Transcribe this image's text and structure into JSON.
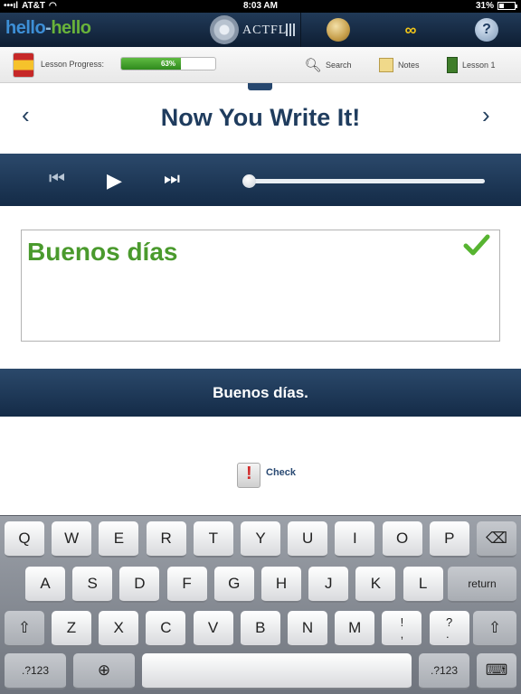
{
  "status_bar": {
    "carrier": "AT&T",
    "time": "8:03 AM",
    "battery": "31%",
    "battery_level": 0.31
  },
  "header": {
    "logo_part1": "hello",
    "logo_sep": "-",
    "logo_part2": "hello",
    "actfl_label": "ACTFL",
    "icons": [
      "globe-icon",
      "glasses-icon",
      "help-icon"
    ],
    "help_glyph": "?"
  },
  "toolbar": {
    "lesson_progress_label": "Lesson Progress:",
    "progress_text": "63%",
    "progress_value": 0.63,
    "search_label": "Search",
    "notes_label": "Notes",
    "lesson_label": "Lesson 1"
  },
  "title_area": {
    "title": "Now You Write It!",
    "prev_glyph": "‹",
    "next_glyph": "›"
  },
  "audio": {
    "rewind_glyph": "⏮",
    "play_glyph": "▶",
    "forward_glyph": "⏭",
    "position": 0.0
  },
  "answer": {
    "text": "Buenos días",
    "status": "correct"
  },
  "translation": {
    "text": "Buenos días."
  },
  "check": {
    "label": "Check"
  },
  "keyboard": {
    "row1": [
      "Q",
      "W",
      "E",
      "R",
      "T",
      "Y",
      "U",
      "I",
      "O",
      "P"
    ],
    "row2": [
      "A",
      "S",
      "D",
      "F",
      "G",
      "H",
      "J",
      "K",
      "L"
    ],
    "row3": [
      "Z",
      "X",
      "C",
      "V",
      "B",
      "N",
      "M",
      "!\n,",
      "?\n."
    ],
    "return_label": "return",
    "numbers_label": ".?123",
    "shift_glyph": "⇧",
    "backspace_glyph": "⌫",
    "globe_glyph": "⊕",
    "hide_glyph": "⌨"
  },
  "colors": {
    "accent_navy": "#1f3c5e",
    "answer_green": "#4a9a2d",
    "progress_green": "#3fa22a"
  }
}
